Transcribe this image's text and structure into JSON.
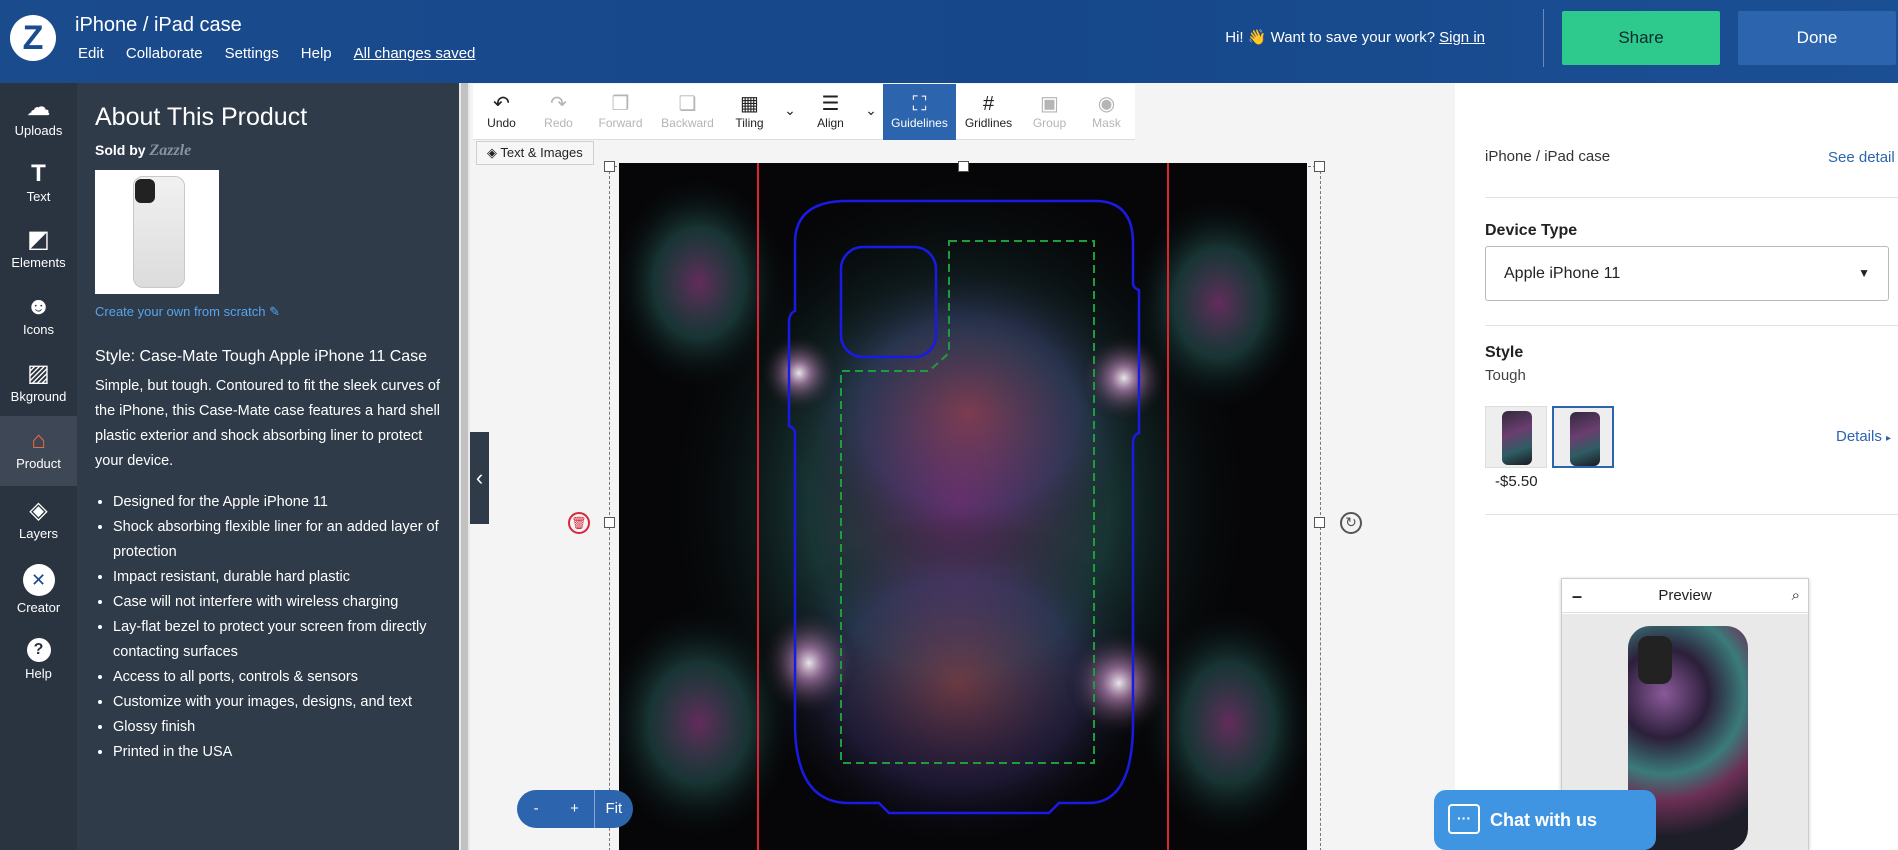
{
  "header": {
    "logo": "Z",
    "title": "iPhone / iPad case",
    "menu": [
      "Edit",
      "Collaborate",
      "Settings",
      "Help"
    ],
    "saved_status": "All changes saved",
    "greeting": "Hi! 👋 Want to save your work?",
    "sign_in": "Sign in",
    "share_label": "Share",
    "done_label": "Done"
  },
  "tools": [
    {
      "label": "Uploads",
      "icon": "cloud-upload-icon",
      "glyph": "☁"
    },
    {
      "label": "Text",
      "icon": "text-icon",
      "glyph": "T"
    },
    {
      "label": "Elements",
      "icon": "elements-icon",
      "glyph": "◩"
    },
    {
      "label": "Icons",
      "icon": "smiley-icon",
      "glyph": "☻"
    },
    {
      "label": "Bkground",
      "icon": "background-icon",
      "glyph": "▨"
    },
    {
      "label": "Product",
      "icon": "product-icon",
      "glyph": "⌂"
    },
    {
      "label": "Layers",
      "icon": "layers-icon",
      "glyph": "◈"
    },
    {
      "label": "Creator",
      "icon": "creator-icon",
      "glyph": "✕"
    },
    {
      "label": "Help",
      "icon": "help-icon",
      "glyph": "?"
    }
  ],
  "about": {
    "heading": "About This Product",
    "sold_by": "Sold by",
    "brand": "Zazzle",
    "create_link": "Create your own from scratch",
    "style_title": "Style: Case-Mate Tough Apple iPhone 11 Case",
    "description": "Simple, but tough. Contoured to fit the sleek curves of the iPhone, this Case-Mate case features a hard shell plastic exterior and shock absorbing liner to protect your device.",
    "bullets": [
      "Designed for the Apple iPhone 11",
      "Shock absorbing flexible liner for an added layer of protection",
      "Impact resistant, durable hard plastic",
      "Case will not interfere with wireless charging",
      "Lay-flat bezel to protect your screen from directly contacting surfaces",
      "Access to all ports, controls & sensors",
      "Customize with your images, designs, and text",
      "Glossy finish",
      "Printed in the USA"
    ]
  },
  "toolbar": [
    {
      "label": "Undo",
      "glyph": "↶",
      "state": "normal",
      "icon": "undo-icon"
    },
    {
      "label": "Redo",
      "glyph": "↷",
      "state": "disabled",
      "icon": "redo-icon"
    },
    {
      "label": "Forward",
      "glyph": "❐",
      "state": "disabled",
      "icon": "forward-icon"
    },
    {
      "label": "Backward",
      "glyph": "❏",
      "state": "disabled",
      "icon": "backward-icon"
    },
    {
      "label": "Tiling",
      "glyph": "▦",
      "state": "normal",
      "icon": "tiling-icon"
    },
    {
      "label": "Align",
      "glyph": "☰",
      "state": "normal",
      "icon": "align-icon"
    },
    {
      "label": "Guidelines",
      "glyph": "⛶",
      "state": "active",
      "icon": "guidelines-icon"
    },
    {
      "label": "Gridlines",
      "glyph": "#",
      "state": "normal",
      "icon": "gridlines-icon"
    },
    {
      "label": "Group",
      "glyph": "▣",
      "state": "disabled",
      "icon": "group-icon"
    },
    {
      "label": "Mask",
      "glyph": "◉",
      "state": "disabled",
      "icon": "mask-icon"
    }
  ],
  "layer_tab": "Text & Images",
  "zoom": {
    "minus": "-",
    "plus": "+",
    "fit": "Fit"
  },
  "right": {
    "product_name": "iPhone / iPad case",
    "see_detail": "See detail",
    "device_label": "Device Type",
    "device_value": "Apple iPhone 11",
    "style_label": "Style",
    "style_value": "Tough",
    "price_delta": "-$5.50",
    "details_link": "Details"
  },
  "preview": {
    "title": "Preview"
  },
  "chat": {
    "label": "Chat with us"
  },
  "colors": {
    "header_bg": "#1a4b8c",
    "share_btn": "#2ec98c",
    "done_btn": "#2c64ad",
    "guideline_red": "#e0242e",
    "guideline_blue": "#1a1ae6",
    "guideline_green": "#1e9e3a"
  }
}
